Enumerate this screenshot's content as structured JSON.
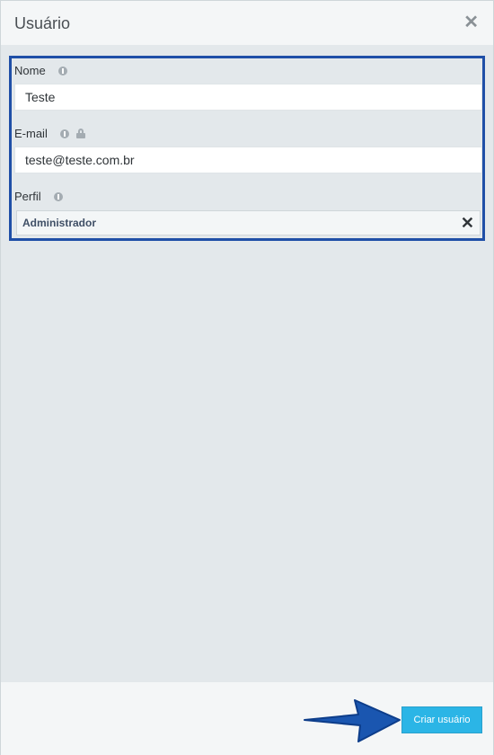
{
  "modal": {
    "title": "Usuário"
  },
  "form": {
    "name_label": "Nome",
    "name_value": "Teste",
    "email_label": "E-mail",
    "email_value": "teste@teste.com.br",
    "profile_label": "Perfil",
    "profile_value": "Administrador"
  },
  "footer": {
    "create_button_label": "Criar usuário"
  },
  "colors": {
    "highlight_border": "#1f4fa7",
    "primary_button": "#2bb5e6",
    "arrow": "#1a56b0"
  },
  "icons": [
    "close-icon",
    "info-icon",
    "lock-icon",
    "clear-icon",
    "arrow-pointer"
  ]
}
